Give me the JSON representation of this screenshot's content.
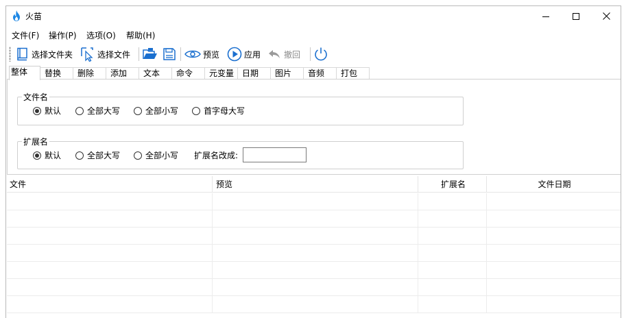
{
  "window": {
    "title": "火苗"
  },
  "menubar": {
    "items": [
      "文件(F)",
      "操作(P)",
      "选项(O)",
      "帮助(H)"
    ]
  },
  "toolbar": {
    "select_folder": "选择文件夹",
    "select_file": "选择文件",
    "preview": "预览",
    "apply": "应用",
    "undo": "撤回"
  },
  "tabs": [
    "整体",
    "替换",
    "删除",
    "添加",
    "文本",
    "命令",
    "元变量",
    "日期",
    "图片",
    "音频",
    "打包"
  ],
  "active_tab": "整体",
  "filename_group": {
    "legend": "文件名",
    "options": [
      "默认",
      "全部大写",
      "全部小写",
      "首字母大写"
    ],
    "selected": "默认"
  },
  "extension_group": {
    "legend": "扩展名",
    "options": [
      "默认",
      "全部大写",
      "全部小写"
    ],
    "selected": "默认",
    "change_label": "扩展名改成:",
    "change_value": ""
  },
  "table": {
    "columns": [
      "文件",
      "预览",
      "扩展名",
      "文件日期"
    ],
    "rows": 7
  },
  "colors": {
    "accent_blue": "#1a6fcf",
    "flame": "#1e88e5"
  }
}
